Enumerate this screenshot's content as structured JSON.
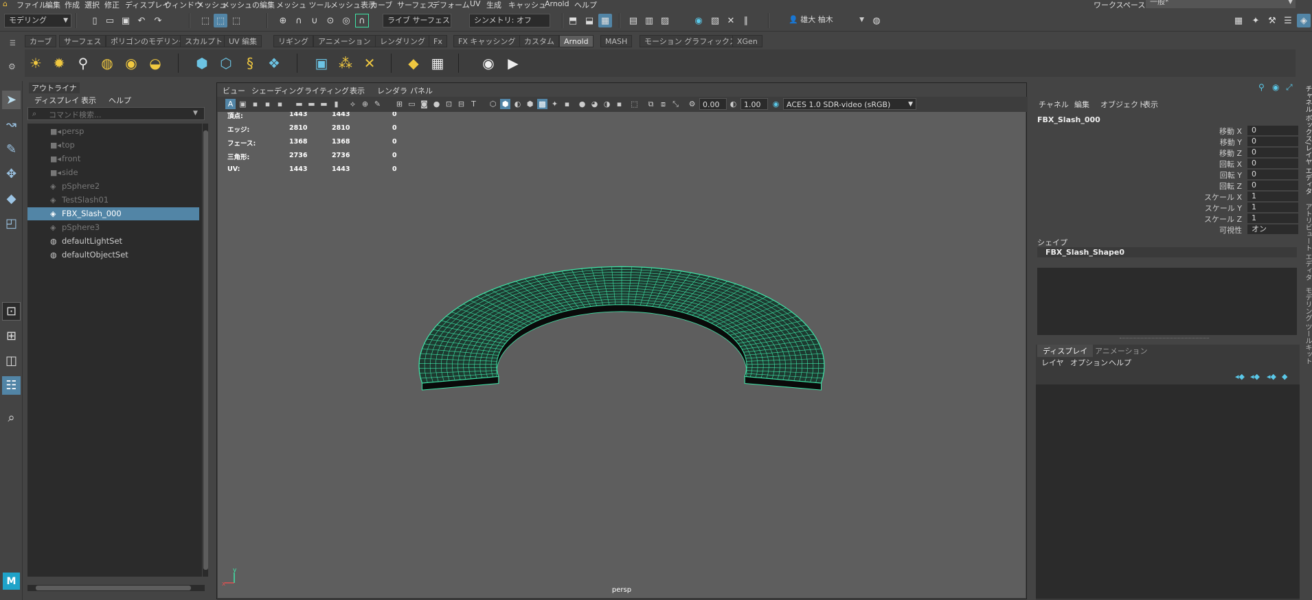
{
  "menubar": {
    "items": [
      "ファイル",
      "編集",
      "作成",
      "選択",
      "修正",
      "ディスプレイ",
      "ウィンドウ",
      "メッシュ",
      "メッシュの編集",
      "メッシュ ツール",
      "メッシュ表示",
      "カーブ",
      "サーフェス",
      "デフォーム",
      "UV",
      "生成",
      "キャッシュ",
      "Arnold",
      "ヘルプ"
    ],
    "workspace_label": "ワークスペース:",
    "workspace_value": "一般*"
  },
  "status": {
    "mode": "モデリング",
    "live_surface": "ライブ サーフェスなし",
    "symmetry": "シンメトリ: オフ",
    "user": "雄大 柚木"
  },
  "shelf": {
    "tabs": [
      "カーブ",
      "サーフェス",
      "ポリゴンのモデリング",
      "スカルプト",
      "UV 編集",
      "リギング",
      "アニメーション",
      "レンダリング",
      "Fx",
      "FX キャッシング",
      "カスタム",
      "Arnold",
      "MASH",
      "モーション グラフィックス",
      "XGen"
    ],
    "active_tab": "Arnold"
  },
  "outliner": {
    "title": "アウトライナ",
    "menu": [
      "ディスプレイ",
      "表示",
      "ヘルプ"
    ],
    "search_placeholder": "コマンド検索...",
    "items": [
      {
        "label": "persp",
        "icon": "camera-icon",
        "dim": true
      },
      {
        "label": "top",
        "icon": "camera-icon",
        "dim": true
      },
      {
        "label": "front",
        "icon": "camera-icon",
        "dim": true
      },
      {
        "label": "side",
        "icon": "camera-icon",
        "dim": true
      },
      {
        "label": "pSphere2",
        "icon": "transform-icon",
        "dim": true
      },
      {
        "label": "TestSlash01",
        "icon": "transform-icon",
        "dim": true
      },
      {
        "label": "FBX_Slash_000",
        "icon": "transform-icon",
        "selected": true
      },
      {
        "label": "pSphere3",
        "icon": "transform-icon",
        "dim": true
      },
      {
        "label": "defaultLightSet",
        "icon": "set-icon"
      },
      {
        "label": "defaultObjectSet",
        "icon": "set-icon"
      }
    ]
  },
  "viewport": {
    "menu": [
      "ビュー",
      "シェーディング",
      "ライティング",
      "表示",
      "レンダラ",
      "パネル"
    ],
    "exposure": "0.00",
    "gamma": "1.00",
    "color_space": "ACES 1.0 SDR-video (sRGB)",
    "hud": [
      {
        "label": "頂点:",
        "v1": "1443",
        "v2": "1443",
        "v3": "0"
      },
      {
        "label": "エッジ:",
        "v1": "2810",
        "v2": "2810",
        "v3": "0"
      },
      {
        "label": "フェース:",
        "v1": "1368",
        "v2": "1368",
        "v3": "0"
      },
      {
        "label": "三角形:",
        "v1": "2736",
        "v2": "2736",
        "v3": "0"
      },
      {
        "label": "UV:",
        "v1": "1443",
        "v2": "1443",
        "v3": "0"
      }
    ],
    "camera_label": "persp",
    "wire_color": "#3fe6a8"
  },
  "channelbox": {
    "menu": [
      "チャネル",
      "編集",
      "オブジェクト",
      "表示"
    ],
    "object_name": "FBX_Slash_000",
    "channels": [
      {
        "label": "移動 X",
        "value": "0"
      },
      {
        "label": "移動 Y",
        "value": "0"
      },
      {
        "label": "移動 Z",
        "value": "0"
      },
      {
        "label": "回転 X",
        "value": "0"
      },
      {
        "label": "回転 Y",
        "value": "0"
      },
      {
        "label": "回転 Z",
        "value": "0"
      },
      {
        "label": "スケール X",
        "value": "1"
      },
      {
        "label": "スケール Y",
        "value": "1"
      },
      {
        "label": "スケール Z",
        "value": "1"
      },
      {
        "label": "可視性",
        "value": "オン"
      }
    ],
    "shape_header": "シェイプ",
    "shape_name": "FBX_Slash_Shape0"
  },
  "layereditor": {
    "tabs": [
      "ディスプレイ",
      "アニメーション"
    ],
    "menu": [
      "レイヤ",
      "オプション",
      "ヘルプ"
    ]
  },
  "side_tabs": [
    "チャネル ボックス/レイヤ エディタ",
    "アトリビュート エディタ",
    "モデリング ツールキット"
  ]
}
